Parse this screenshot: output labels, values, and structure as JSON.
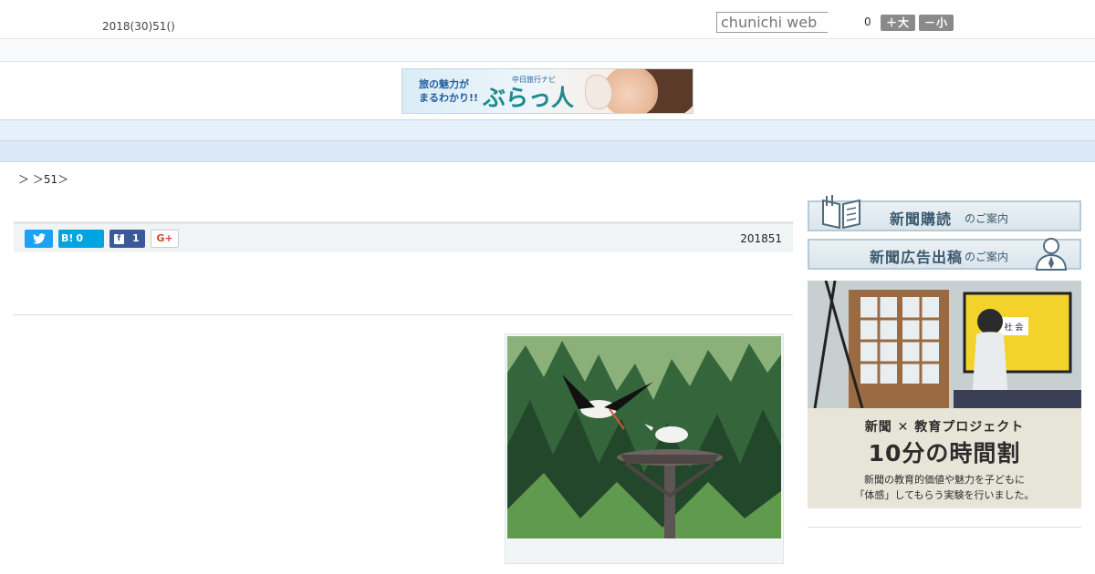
{
  "header": {
    "date": "2018(30)51()",
    "search_placeholder": "chunichi web",
    "count": "0",
    "font_plus": "＋大",
    "font_minus": "－小"
  },
  "banner": {
    "line1": "旅の魅力が",
    "line2": "まるわかり!!",
    "small": "中日旅行ナビ",
    "brand": "ぶらっ人"
  },
  "nav": {
    "items": [
      "　　",
      "　　",
      "　　",
      "　　",
      "　　",
      "　　",
      "　　",
      "　　",
      "　　"
    ]
  },
  "breadcrumb": "＞ ＞51＞",
  "share": {
    "hatena_label": "B!",
    "hatena_count": "0",
    "facebook_count": "1",
    "gplus_label": "G+",
    "date": "201851"
  },
  "sidebar": {
    "subscribe_main": "新聞購読",
    "subscribe_sub": "のご案内",
    "ads_main": "新聞広告出稿",
    "ads_sub": "のご案内",
    "promo_line1": "新聞 ✕ 教育プロジェクト",
    "promo_line2": "10分の時間割",
    "promo_line3": "新聞の教育的価値や魅力を子どもに",
    "promo_line4": "「体感」してもらう実験を行いました。",
    "promo_screen_text": "社 会"
  },
  "colors": {
    "nav_bg": "#e6f0fa",
    "twitter": "#1da1f2",
    "hatena": "#00a4de",
    "facebook": "#3b5998",
    "gplus": "#d14836"
  }
}
